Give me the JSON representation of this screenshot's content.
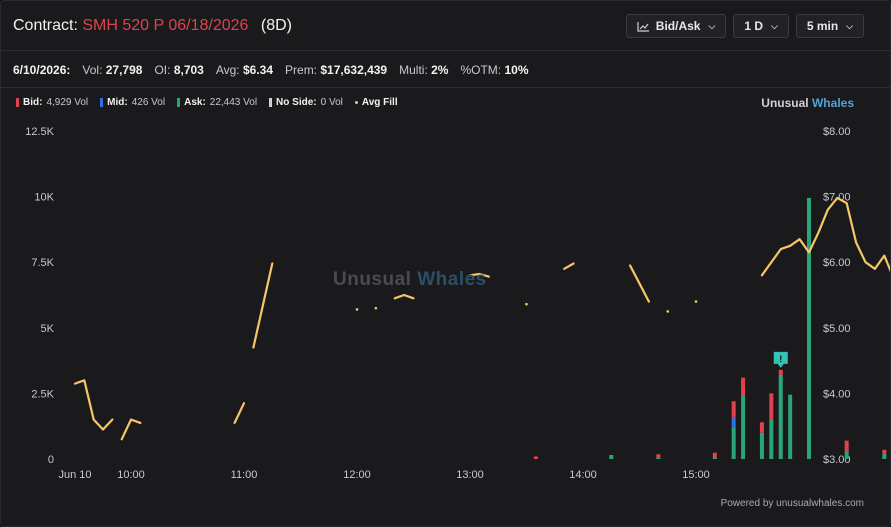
{
  "header": {
    "prefix": "Contract:",
    "contract": "SMH 520 P 06/18/2026",
    "dte": "(8D)"
  },
  "controls": {
    "mode": "Bid/Ask",
    "range": "1 D",
    "interval": "5 min"
  },
  "stats": {
    "date": "6/10/2026:",
    "vol_label": "Vol:",
    "vol": "27,798",
    "oi_label": "OI:",
    "oi": "8,703",
    "avg_label": "Avg:",
    "avg": "$6.34",
    "prem_label": "Prem:",
    "prem": "$17,632,439",
    "multi_label": "Multi:",
    "multi": "2%",
    "otm_label": "%OTM:",
    "otm": "10%"
  },
  "legend": {
    "bid_label": "Bid:",
    "bid": "4,929 Vol",
    "mid_label": "Mid:",
    "mid": "426 Vol",
    "ask_label": "Ask:",
    "ask": "22,443 Vol",
    "noside_label": "No Side:",
    "noside": "0 Vol",
    "avgfill_label": "Avg Fill"
  },
  "brand": {
    "a": "Unusual",
    "b": "Whales"
  },
  "watermark": {
    "a": "Unusual",
    "b": "Whales"
  },
  "powered": "Powered by unusualwhales.com",
  "colors": {
    "bid": "#e0424d",
    "mid": "#2f6fe0",
    "ask": "#2aa57a",
    "avg_fill": "#f6c667",
    "background": "#1a1a1d"
  },
  "chart_data": {
    "type": "bar",
    "left_axis": {
      "ticks": [
        "0",
        "2.5K",
        "5K",
        "7.5K",
        "10K",
        "12.5K"
      ],
      "values": [
        0,
        2500,
        5000,
        7500,
        10000,
        12500
      ],
      "ylim": [
        0,
        12500
      ]
    },
    "right_axis": {
      "ticks": [
        "$3.00",
        "$4.00",
        "$5.00",
        "$6.00",
        "$7.00",
        "$8.00"
      ],
      "values": [
        3,
        4,
        5,
        6,
        7,
        8
      ],
      "ylim": [
        3,
        8
      ]
    },
    "x_ticks": [
      "Jun 10",
      "10:00",
      "11:00",
      "12:00",
      "13:00",
      "14:00",
      "15:00"
    ],
    "x_tick_minutes": [
      570,
      600,
      660,
      720,
      780,
      840,
      900
    ],
    "x_range_minutes": [
      570,
      960
    ],
    "bars": [
      {
        "t": 855,
        "ask": 150,
        "mid": 0,
        "bid": 0
      },
      {
        "t": 880,
        "ask": 40,
        "mid": 0,
        "bid": 140
      },
      {
        "t": 910,
        "ask": 60,
        "mid": 0,
        "bid": 180
      },
      {
        "t": 920,
        "ask": 1200,
        "mid": 400,
        "bid": 600
      },
      {
        "t": 925,
        "ask": 2400,
        "mid": 0,
        "bid": 700
      },
      {
        "t": 935,
        "ask": 1000,
        "mid": 0,
        "bid": 400
      },
      {
        "t": 940,
        "ask": 1500,
        "mid": 0,
        "bid": 1000
      },
      {
        "t": 945,
        "ask": 3200,
        "mid": 0,
        "bid": 200
      },
      {
        "t": 950,
        "ask": 2450,
        "mid": 0,
        "bid": 0
      },
      {
        "t": 960,
        "ask": 9950,
        "mid": 0,
        "bid": 0
      },
      {
        "t": 815,
        "ask": 0,
        "mid": 0,
        "bid": 100
      },
      {
        "t": 980,
        "ask": 300,
        "mid": 0,
        "bid": 400
      },
      {
        "t": 1000,
        "ask": 200,
        "mid": 0,
        "bid": 150
      },
      {
        "t": 1010,
        "ask": 150,
        "mid": 0,
        "bid": 0
      }
    ],
    "avg_fill_segments": [
      [
        [
          570,
          4.15
        ],
        [
          575,
          4.2
        ],
        [
          580,
          3.6
        ],
        [
          585,
          3.45
        ],
        [
          590,
          3.6
        ]
      ],
      [
        [
          595,
          3.3
        ],
        [
          600,
          3.6
        ],
        [
          605,
          3.55
        ]
      ],
      [
        [
          655,
          3.55
        ],
        [
          660,
          3.85
        ]
      ],
      [
        [
          665,
          4.7
        ],
        [
          675,
          5.98
        ]
      ],
      [
        [
          720,
          5.28
        ]
      ],
      [
        [
          730,
          5.3
        ]
      ],
      [
        [
          740,
          5.45
        ],
        [
          745,
          5.5
        ],
        [
          750,
          5.45
        ]
      ],
      [
        [
          780,
          5.8
        ],
        [
          785,
          5.82
        ],
        [
          790,
          5.78
        ]
      ],
      [
        [
          810,
          5.36
        ]
      ],
      [
        [
          830,
          5.9
        ],
        [
          835,
          5.98
        ]
      ],
      [
        [
          865,
          5.95
        ],
        [
          875,
          5.4
        ]
      ],
      [
        [
          885,
          5.25
        ]
      ],
      [
        [
          900,
          5.4
        ]
      ],
      [
        [
          935,
          5.8
        ],
        [
          945,
          6.2
        ],
        [
          950,
          6.25
        ],
        [
          955,
          6.35
        ],
        [
          960,
          6.15
        ],
        [
          965,
          6.45
        ],
        [
          970,
          6.8
        ],
        [
          975,
          6.98
        ],
        [
          980,
          6.9
        ],
        [
          985,
          6.3
        ],
        [
          990,
          6.0
        ],
        [
          995,
          5.9
        ],
        [
          1000,
          6.1
        ],
        [
          1005,
          5.75
        ]
      ]
    ]
  }
}
